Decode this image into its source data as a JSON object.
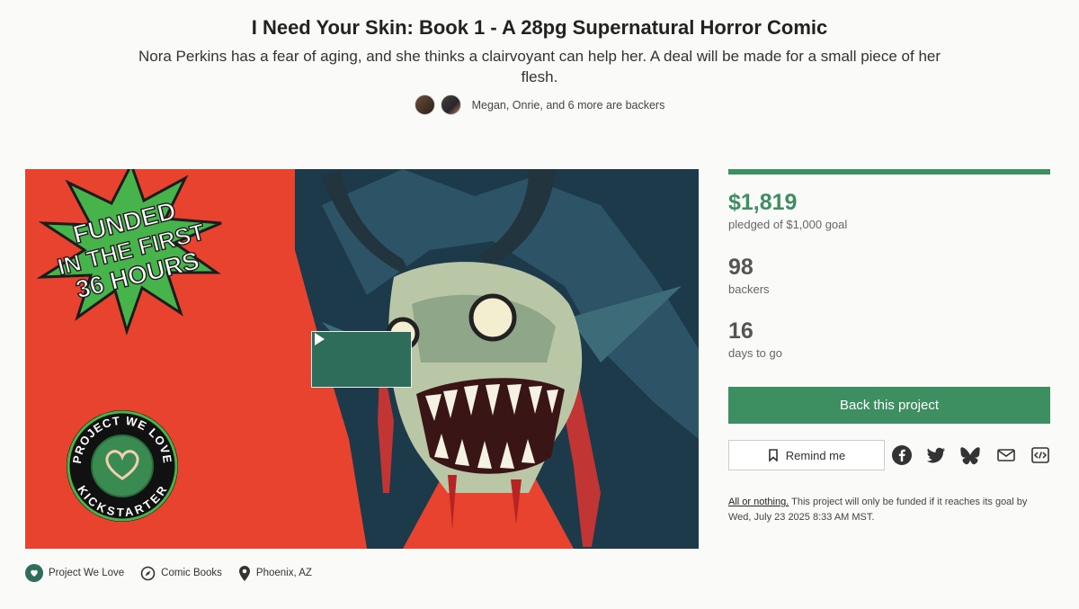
{
  "project": {
    "title": "I Need Your Skin: Book 1 - A 28pg Supernatural Horror Comic",
    "blurb": "Nora Perkins has a fear of aging, and she thinks a clairvoyant can help her. A deal will be made for a small piece of her flesh.",
    "backers_note": "Megan, Onrie, and 6 more are backers"
  },
  "hero": {
    "badge_lines": [
      "FUNDED",
      "IN THE FIRST",
      "36 HOURS"
    ],
    "seal_top": "PROJECT WE LOVE",
    "seal_bottom": "KICKSTARTER",
    "play_icon": "play-icon"
  },
  "stats": {
    "pledged": "$1,819",
    "pledged_label": "pledged of $1,000 goal",
    "backers": "98",
    "backers_label": "backers",
    "days": "16",
    "days_label": "days to go",
    "funding_progress": 1.0
  },
  "actions": {
    "back_label": "Back this project",
    "remind_label": "Remind me",
    "share_icons": [
      "facebook-icon",
      "twitter-icon",
      "bluesky-icon",
      "mail-icon",
      "embed-icon"
    ]
  },
  "note": {
    "link": "All or nothing.",
    "text": " This project will only be funded if it reaches its goal by Wed, July 23 2025 8:33 AM MST."
  },
  "tags": [
    {
      "label": "Project We Love",
      "icon": "kickstarter-badge-icon"
    },
    {
      "label": "Comic Books",
      "icon": "compass-icon"
    },
    {
      "label": "Phoenix, AZ",
      "icon": "location-pin-icon"
    }
  ],
  "colors": {
    "accent": "#3d8f62",
    "hero_bg": "#e8432f",
    "play_button": "#2f6d5b"
  }
}
